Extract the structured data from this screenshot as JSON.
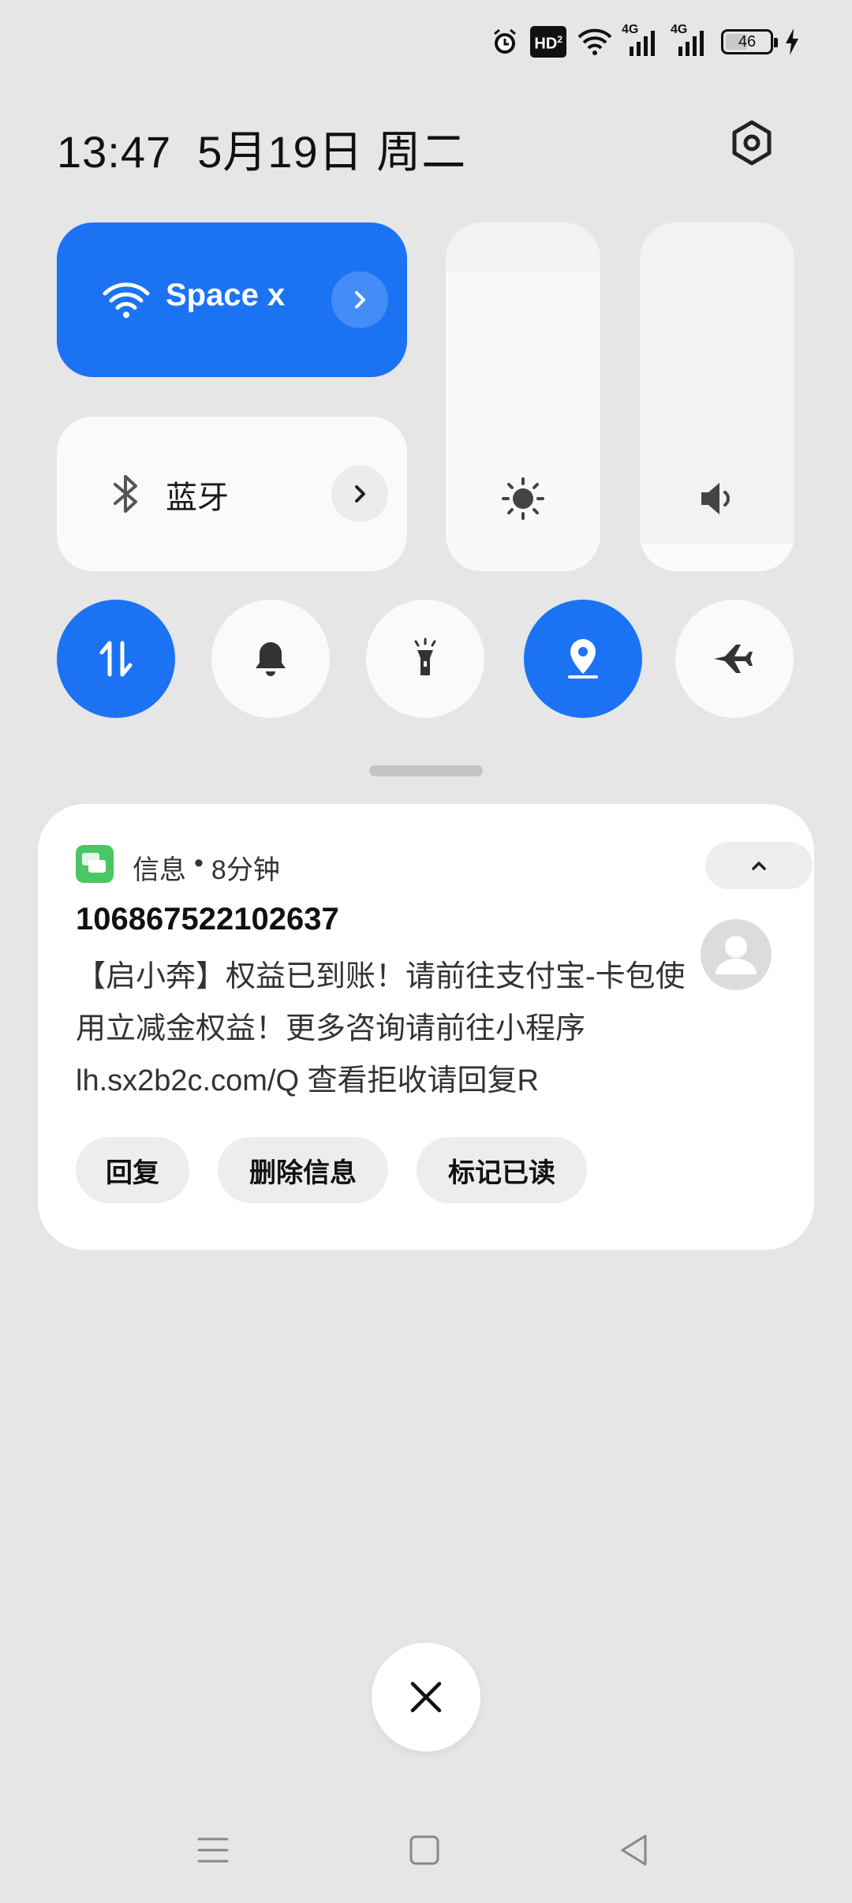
{
  "status_bar": {
    "hd_label": "HD",
    "hd_sub": "2",
    "network1": "4G",
    "network2": "4G",
    "battery_level": "46",
    "icons": [
      "alarm-icon",
      "hd-voice-icon",
      "wifi-icon",
      "signal-4g-icon",
      "signal-4g-icon",
      "battery-icon",
      "charging-icon"
    ]
  },
  "header": {
    "time": "13:47",
    "date": "5月19日",
    "weekday": "周二",
    "settings_icon": "settings-icon"
  },
  "tiles": {
    "wifi": {
      "label": "Space x",
      "active": true,
      "icon": "wifi-icon"
    },
    "bluetooth": {
      "label": "蓝牙",
      "active": false,
      "icon": "bluetooth-icon"
    }
  },
  "sliders": {
    "brightness": {
      "icon": "brightness-icon",
      "level_percent": 86
    },
    "volume": {
      "icon": "volume-icon",
      "level_percent": 8
    }
  },
  "toggles": [
    {
      "name": "mobile-data",
      "icon": "data-transfer-icon",
      "active": true
    },
    {
      "name": "ring-mode",
      "icon": "bell-icon",
      "active": false
    },
    {
      "name": "flashlight",
      "icon": "flashlight-icon",
      "active": false
    },
    {
      "name": "location",
      "icon": "location-icon",
      "active": true
    },
    {
      "name": "airplane-mode",
      "icon": "airplane-icon",
      "active": false
    }
  ],
  "notification": {
    "app": "信息",
    "separator": "•",
    "time_ago": "8分钟",
    "sender": "106867522102637",
    "body": "【启小奔】权益已到账！请前往支付宝-卡包使用立减金权益！更多咨询请前往小程序lh.sx2b2c.com/Q 查看拒收请回复R",
    "actions": {
      "reply": "回复",
      "delete": "删除信息",
      "mark_read": "标记已读"
    }
  },
  "colors": {
    "accent": "#1b73f4",
    "background": "#e6e6e6",
    "tile_inactive": "#fafafa",
    "message_app": "#48c764"
  }
}
